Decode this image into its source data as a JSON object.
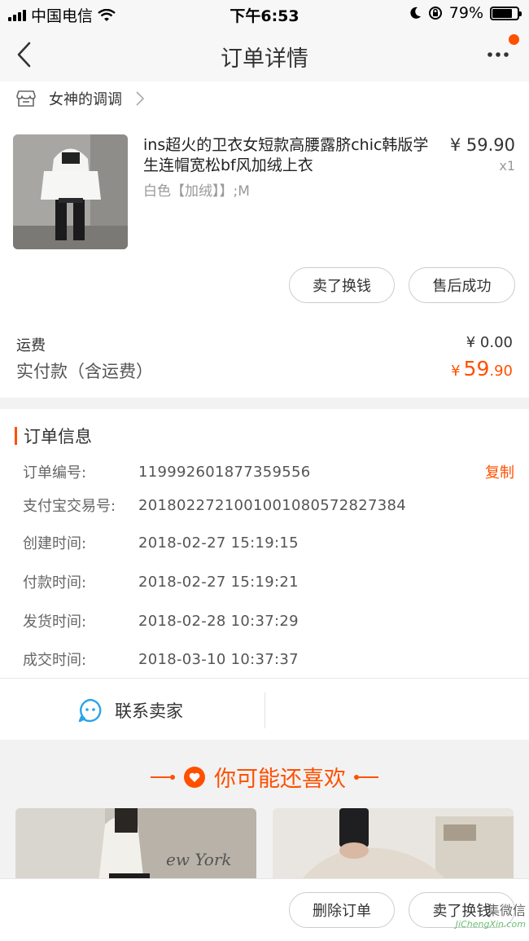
{
  "status_bar": {
    "carrier": "中国电信",
    "time": "下午6:53",
    "battery": "79%",
    "battery_level": 0.79
  },
  "nav": {
    "title": "订单详情"
  },
  "shop": {
    "name": "女神的调调"
  },
  "product": {
    "title": "ins超火的卫衣女短款高腰露脐chic韩版学生连帽宽松bf风加绒上衣",
    "spec": "白色【加绒】】;M",
    "price": "¥ 59.90",
    "qty": "x1"
  },
  "item_actions": {
    "sell_label": "卖了换钱",
    "aftersale_label": "售后成功"
  },
  "summary": {
    "shipping_label": "运费",
    "shipping_value": "¥ 0.00",
    "paid_label": "实付款（含运费）",
    "paid_currency": "¥",
    "paid_int": "59",
    "paid_dec": ".90"
  },
  "order_info": {
    "title": "订单信息",
    "copy_label": "复制",
    "rows": [
      {
        "label": "订单编号:",
        "value": "119992601877359556"
      },
      {
        "label": "支付宝交易号:",
        "value": "2018022721001001080572827384"
      },
      {
        "label": "创建时间:",
        "value": "2018-02-27 15:19:15"
      },
      {
        "label": "付款时间:",
        "value": "2018-02-27 15:19:21"
      },
      {
        "label": "发货时间:",
        "value": "2018-02-28 10:37:29"
      },
      {
        "label": "成交时间:",
        "value": "2018-03-10 10:37:37"
      }
    ]
  },
  "contact": {
    "label": "联系卖家"
  },
  "recommend": {
    "title": "你可能还喜欢",
    "sign_text": "ew York"
  },
  "bottom_bar": {
    "delete_label": "删除订单",
    "sell_label": "卖了换钱"
  },
  "watermark": {
    "glyphs": "集微信",
    "url": "JiChengXin.com"
  },
  "colors": {
    "accent": "#ff5000",
    "contact_icon": "#2aa3e6"
  }
}
